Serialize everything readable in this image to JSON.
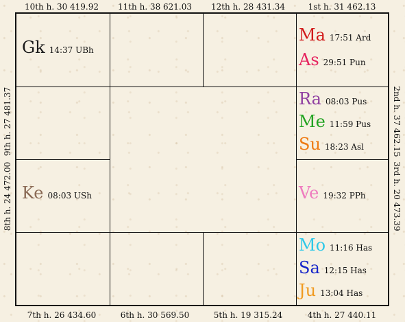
{
  "houses": {
    "h10": "10th h.  30  419.92",
    "h11": "11th h.  38  621.03",
    "h12": "12th h.  28  431.34",
    "h1": "1st h.  31  462.13",
    "h9": "9th h.  27  481.37",
    "h8": "8th h.  24  472.00",
    "h2": "2nd h.  37  462.15",
    "h3": "3rd h.  20  473.39",
    "h7": "7th h.  26  434.60",
    "h6": "6th h.  30  569.50",
    "h5": "5th h.  19  315.24",
    "h4": "4th h.  27  440.11"
  },
  "planets": {
    "gk": {
      "abbr": "Gk",
      "info": "14:37 UBh",
      "color": "#1a1a1a"
    },
    "ma": {
      "abbr": "Ma",
      "info": "17:51 Ard",
      "color": "#d11a1a"
    },
    "as": {
      "abbr": "As",
      "info": "29:51 Pun",
      "color": "#e6225e"
    },
    "ra": {
      "abbr": "Ra",
      "info": "08:03 Pus",
      "color": "#8e3da0"
    },
    "me": {
      "abbr": "Me",
      "info": "11:59 Pus",
      "color": "#22a322"
    },
    "su": {
      "abbr": "Su",
      "info": "18:23 Asl",
      "color": "#ee7a12"
    },
    "ke": {
      "abbr": "Ke",
      "info": "08:03 USh",
      "color": "#8a6a55"
    },
    "ve": {
      "abbr": "Ve",
      "info": "19:32 PPh",
      "color": "#ef7bbf"
    },
    "mo": {
      "abbr": "Mo",
      "info": "11:16 Has",
      "color": "#2ec8e8"
    },
    "sa": {
      "abbr": "Sa",
      "info": "12:15 Has",
      "color": "#1524c9"
    },
    "ju": {
      "abbr": "Ju",
      "info": "13:04 Has",
      "color": "#f09a20"
    }
  }
}
